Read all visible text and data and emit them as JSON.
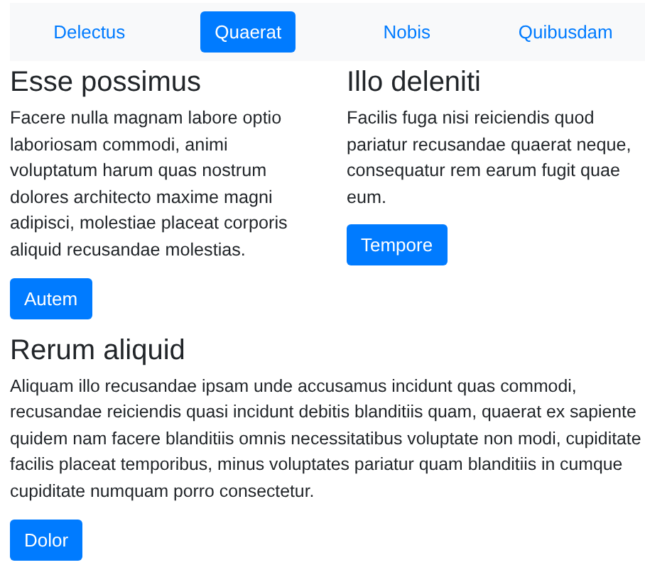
{
  "nav": {
    "tabs": [
      {
        "label": "Delectus",
        "selected": false
      },
      {
        "label": "Quaerat",
        "selected": true
      },
      {
        "label": "Nobis",
        "selected": false
      },
      {
        "label": "Quibusdam",
        "selected": false
      }
    ]
  },
  "columns": [
    {
      "heading": "Esse possimus",
      "lines": [
        "Facere nulla magnam labore optio",
        "laboriosam commodi, animi",
        "voluptatum harum quas nostrum",
        "dolores architecto maxime magni",
        "adipisci, molestiae placeat corporis",
        "aliquid recusandae molestias."
      ],
      "button": "Autem"
    },
    {
      "heading": "Illo deleniti",
      "lines": [
        "Facilis fuga nisi reiciendis quod",
        "pariatur recusandae quaerat neque,",
        "consequatur rem earum fugit quae",
        "eum."
      ],
      "button": "Tempore"
    }
  ],
  "section": {
    "heading": "Rerum aliquid",
    "lines": [
      "Aliquam illo recusandae ipsam unde accusamus incidunt quas commodi,",
      "recusandae reiciendis quasi incidunt debitis blanditiis quam, quaerat ex sapiente",
      "quidem nam facere blanditiis omnis necessitatibus voluptate non modi, cupiditate",
      "facilis placeat temporibus, minus voluptates pariatur quam blanditiis in cumque",
      "cupiditate numquam porro consectetur."
    ],
    "button": "Dolor"
  }
}
